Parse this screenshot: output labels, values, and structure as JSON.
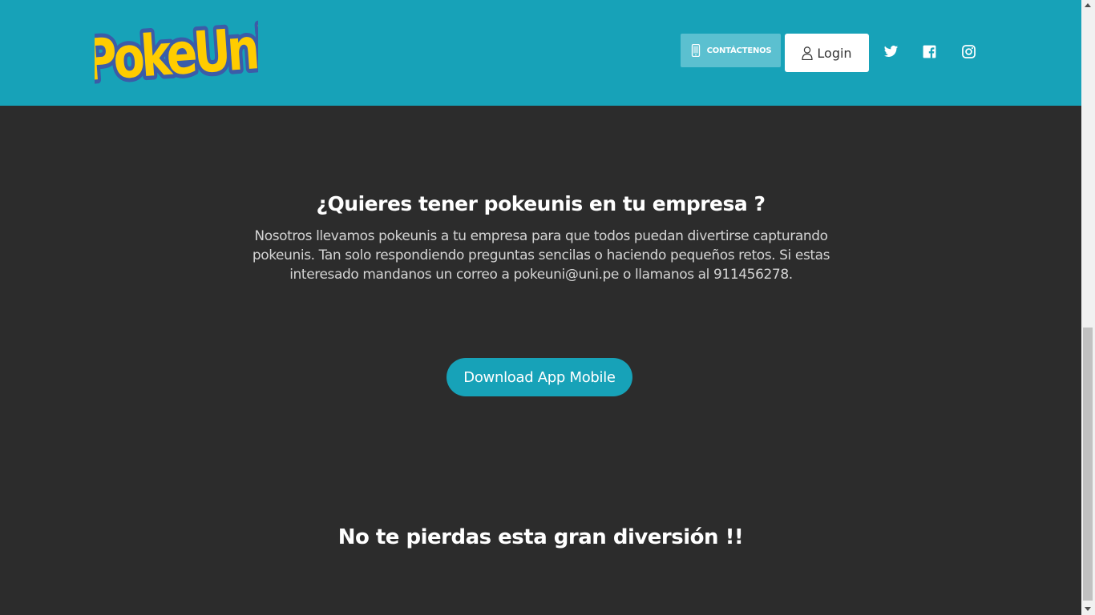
{
  "header": {
    "logo_text": "PokeUni",
    "contact_label": "CONTÁCTENOS",
    "login_label": "Login",
    "social": [
      "twitter-icon",
      "facebook-icon",
      "instagram-icon"
    ]
  },
  "main": {
    "title": "¿Quieres tener pokeunis en tu empresa ?",
    "text": "Nosotros llevamos pokeunis a tu empresa para que todos puedan divertirse capturando pokeunis. Tan solo respondiendo preguntas sencilas o haciendo pequeños retos. Si estas interesado mandanos un correo a pokeuni@uni.pe o llamanos al 911456278.",
    "download_label": "Download App Mobile"
  },
  "footer": {
    "title": "No te pierdas esta gran diversión !!"
  },
  "colors": {
    "header_bg": "#17a2b8",
    "page_bg": "#2c2c2c",
    "accent": "#17a2b8",
    "logo_fill": "#ffcc00",
    "logo_outline": "#3b5ca8"
  }
}
